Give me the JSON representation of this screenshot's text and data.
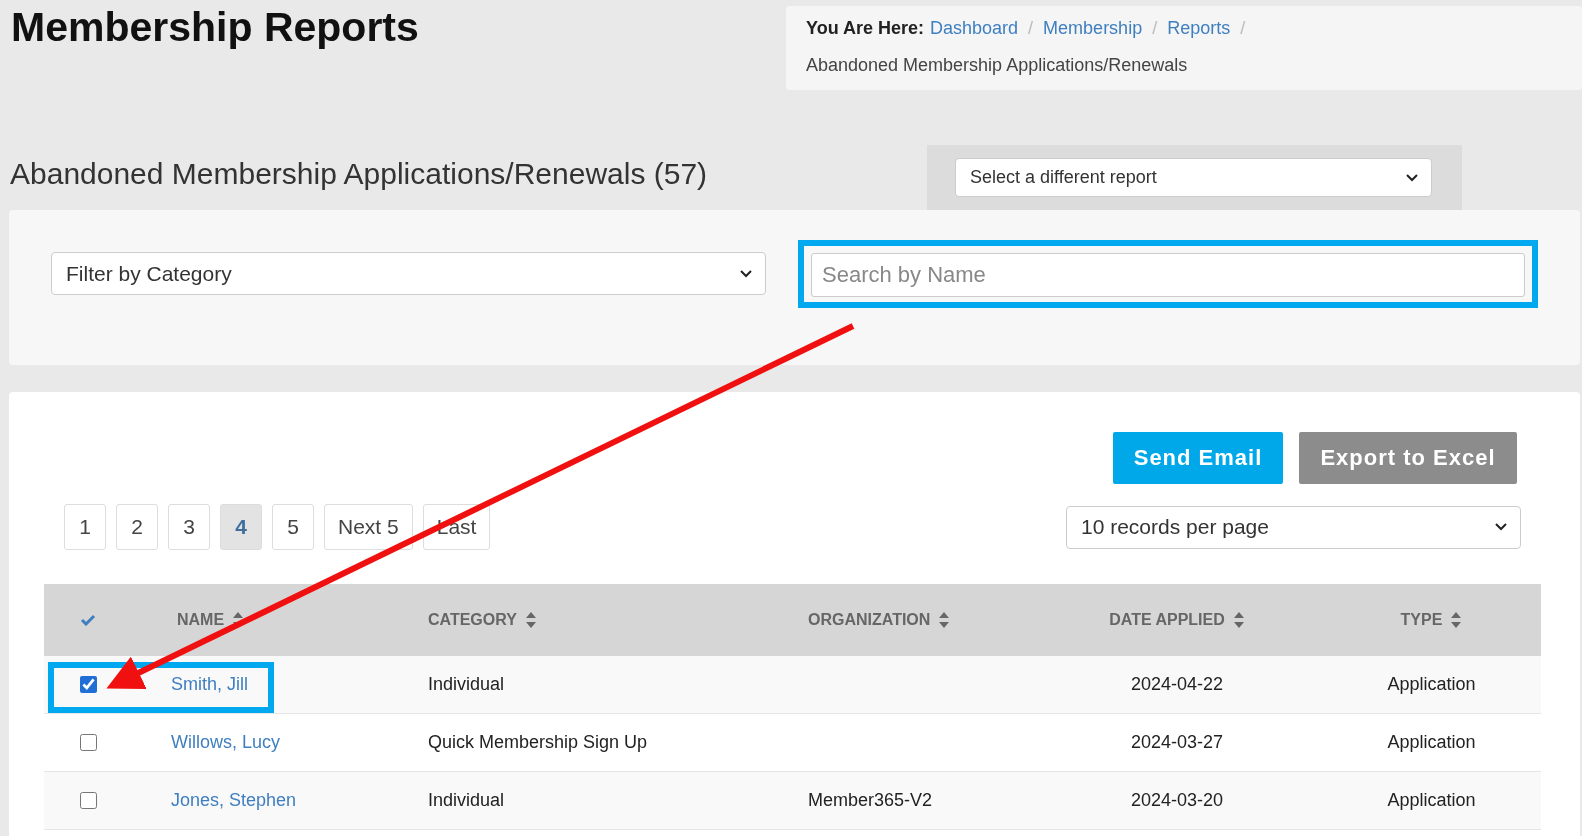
{
  "page_title": "Membership Reports",
  "breadcrumb": {
    "label": "You Are Here:",
    "separator": "/",
    "items": [
      {
        "text": "Dashboard",
        "link": true
      },
      {
        "text": "Membership",
        "link": true
      },
      {
        "text": "Reports",
        "link": true
      },
      {
        "text": "Abandoned Membership Applications/Renewals",
        "link": false
      }
    ]
  },
  "report_heading": "Abandoned Membership Applications/Renewals (57)",
  "report_select": {
    "value": "Select a different report"
  },
  "filter_select": {
    "value": "Filter by Category"
  },
  "search": {
    "placeholder": "Search by Name",
    "highlighted": true
  },
  "buttons": [
    {
      "label": "Send Email",
      "kind": "primary"
    },
    {
      "label": "Export to Excel",
      "kind": "secondary"
    }
  ],
  "pagination": [
    {
      "label": "1",
      "selected": false
    },
    {
      "label": "2",
      "selected": false
    },
    {
      "label": "3",
      "selected": false
    },
    {
      "label": "4",
      "selected": true
    },
    {
      "label": "5",
      "selected": false
    },
    {
      "label": "Next 5",
      "selected": false
    },
    {
      "label": "Last",
      "selected": false
    }
  ],
  "per_page": {
    "value": "10 records per page"
  },
  "table": {
    "columns": [
      "NAME",
      "CATEGORY",
      "ORGANIZATION",
      "DATE APPLIED",
      "TYPE"
    ],
    "rows": [
      {
        "checked": true,
        "highlighted": true,
        "name": "Smith, Jill",
        "category": "Individual",
        "date": "2024-04-22",
        "type": "Application"
      },
      {
        "checked": false,
        "highlighted": false,
        "name": "Willows, Lucy",
        "category": "Quick Membership Sign Up",
        "date": "2024-03-27",
        "type": "Application"
      },
      {
        "checked": false,
        "highlighted": false,
        "name": "Jones, Stephen",
        "category": "Individual",
        "organization": "Member365-V2",
        "date": "2024-03-20",
        "type": "Application"
      }
    ]
  }
}
